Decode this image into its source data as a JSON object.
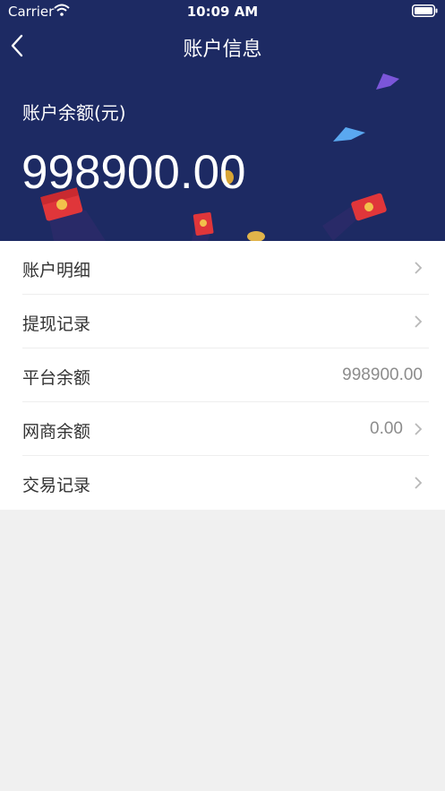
{
  "status_bar": {
    "carrier": "Carrier",
    "time": "10:09 AM"
  },
  "nav": {
    "title": "账户信息"
  },
  "balance": {
    "label": "账户余额(元)",
    "value": "998900.00"
  },
  "menu": [
    {
      "label": "账户明细",
      "value": "",
      "arrow": true
    },
    {
      "label": "提现记录",
      "value": "",
      "arrow": true
    },
    {
      "label": "平台余额",
      "value": "998900.00",
      "arrow": false
    },
    {
      "label": "网商余额",
      "value": "0.00",
      "arrow": true
    },
    {
      "label": "交易记录",
      "value": "",
      "arrow": true
    }
  ],
  "colors": {
    "header_bg": "#1d2a63",
    "page_bg": "#f0f0f0",
    "text_primary": "#333333",
    "text_secondary": "#8c8c8c"
  },
  "icons": [
    "wifi-icon",
    "battery-icon",
    "back-arrow-icon",
    "chevron-right-icon",
    "red-envelope-icon",
    "gold-coin-icon"
  ]
}
